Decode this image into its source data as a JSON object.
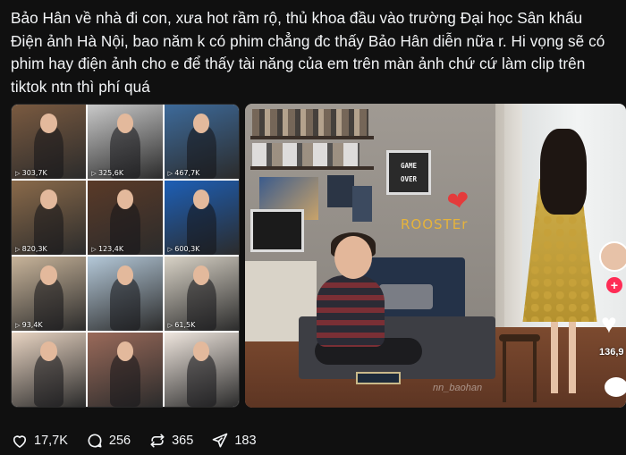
{
  "post": {
    "text": "Bảo Hân về nhà đi con, xưa hot rầm rộ, thủ khoa đầu vào trường Đại học Sân khấu Điện ảnh Hà Nội, bao năm k có phim chẳng đc thấy Bảo Hân diễn nữa r. Hi vọng sẽ có phim hay điện ảnh cho e để thấy tài năng của em trên màn ảnh chứ cứ làm clip trên tiktok ntn thì phí quá"
  },
  "grid": {
    "tiles": [
      {
        "views": "303,7K",
        "bg": "#7a5a40"
      },
      {
        "views": "325,6K",
        "bg": "#c9c9c9"
      },
      {
        "views": "467,7K",
        "bg": "#3d6a9a"
      },
      {
        "views": "820,3K",
        "bg": "#8a6a4a"
      },
      {
        "views": "123,4K",
        "bg": "#5a3a28"
      },
      {
        "views": "600,3K",
        "bg": "#1d5fb6"
      },
      {
        "views": "93,4K",
        "bg": "#c8b49a"
      },
      {
        "views": "",
        "bg": "#b4c8d8"
      },
      {
        "views": "61,5K",
        "bg": "#d8d2c6"
      },
      {
        "views": "",
        "bg": "#e8d4c2"
      },
      {
        "views": "",
        "bg": "#9a6a5a"
      },
      {
        "views": "",
        "bg": "#efe6de"
      }
    ]
  },
  "scene": {
    "sign_line1": "GAME",
    "sign_line2": "OVER",
    "wall_text": "ROOSTEr",
    "watermark": "nn_baohan",
    "likes": "136,9"
  },
  "actions": {
    "likes": "17,7K",
    "comments": "256",
    "reposts": "365",
    "shares": "183"
  }
}
